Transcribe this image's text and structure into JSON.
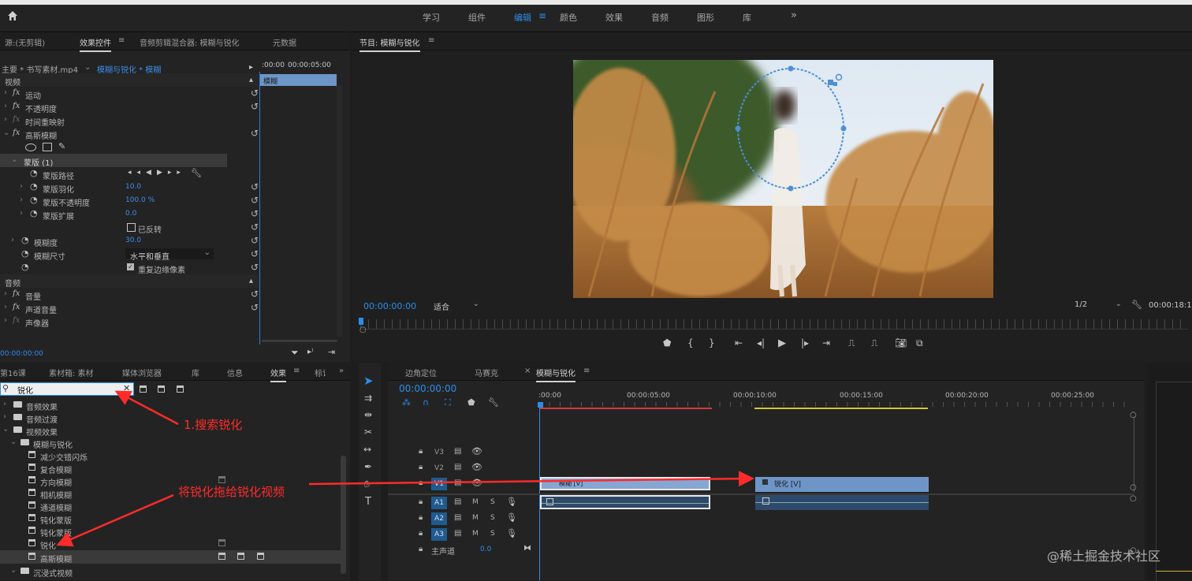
{
  "menubar": {
    "label": ""
  },
  "workspace": {
    "tabs": [
      "学习",
      "组件",
      "编辑",
      "颜色",
      "效果",
      "音频",
      "图形",
      "库"
    ],
    "active": "编辑",
    "more": "»"
  },
  "source_panel": {
    "tabs": [
      "源:(无剪辑)",
      "效果控件",
      "音频剪辑混合器: 模糊与锐化",
      "元数据"
    ],
    "active_tab": "效果控件",
    "clip_main": "主要 * 书写素材.mp4",
    "clip_seq": "模糊与锐化 * 模糊",
    "time_start": ":00:00",
    "time_end": "00:00:05:00",
    "mini_clip_label": "模糊",
    "section_video": "视频",
    "section_audio": "音频",
    "bottom_time": "00:00:00:00",
    "rows": {
      "motion": "运动",
      "opacity": "不透明度",
      "time_remap": "时间重映射",
      "gauss": "高斯模糊",
      "mask": "蒙版 (1)",
      "mask_path": "蒙版路径",
      "mask_feather": "蒙版羽化",
      "mask_feather_val": "10.0",
      "mask_opacity": "蒙版不透明度",
      "mask_opacity_val": "100.0 %",
      "mask_expand": "蒙版扩展",
      "mask_expand_val": "0.0",
      "inverted": "已反转",
      "blurriness": "模糊度",
      "blurriness_val": "30.0",
      "blur_dim": "模糊尺寸",
      "blur_dim_val": "水平和垂直",
      "repeat_edge": "重复边缘像素",
      "volume": "音量",
      "channel_volume": "声道音量",
      "panner": "声像器"
    }
  },
  "program_monitor": {
    "title": "节目: 模糊与锐化",
    "timecode": "00:00:00:00",
    "fit": "适合",
    "resolution": "1/2",
    "duration": "00:00:18:1"
  },
  "effects_panel": {
    "tabs": [
      "第16课",
      "素材箱: 素材",
      "媒体浏览器",
      "库",
      "信息",
      "效果",
      "标记"
    ],
    "active_tab": "效果",
    "search_value": "锐化",
    "tree": {
      "audio_effects": "音频效果",
      "audio_trans": "音频过渡",
      "video_effects": "视频效果",
      "blur_sharpen": "模糊与锐化",
      "items": [
        "减少交错闪烁",
        "复合模糊",
        "方向模糊",
        "相机模糊",
        "通道模糊",
        "钝化蒙版",
        "钝化蒙版",
        "锐化",
        "高斯模糊"
      ],
      "immersive": "沉浸式视频"
    }
  },
  "timeline": {
    "tabs": [
      "边角定位",
      "马赛克",
      "模糊与锐化"
    ],
    "active_tab": "模糊与锐化",
    "timecode": "00:00:00:00",
    "ruler": [
      ":00:00",
      "00:00:05:00",
      "00:00:10:00",
      "00:00:15:00",
      "00:00:20:00",
      "00:00:25:00"
    ],
    "tracks_video": [
      "V3",
      "V2",
      "V1"
    ],
    "tracks_audio": [
      "A1",
      "A2",
      "A3"
    ],
    "master": "主声道",
    "master_val": "0.0",
    "clip_blur": "模糊 [V]",
    "clip_sharpen": "锐化 [V]",
    "btn_m": "M",
    "btn_s": "S"
  },
  "annotations": {
    "step1": "1.搜索锐化",
    "step2": "将锐化拖给锐化视频"
  },
  "watermark": "@稀土掘金技术社区"
}
